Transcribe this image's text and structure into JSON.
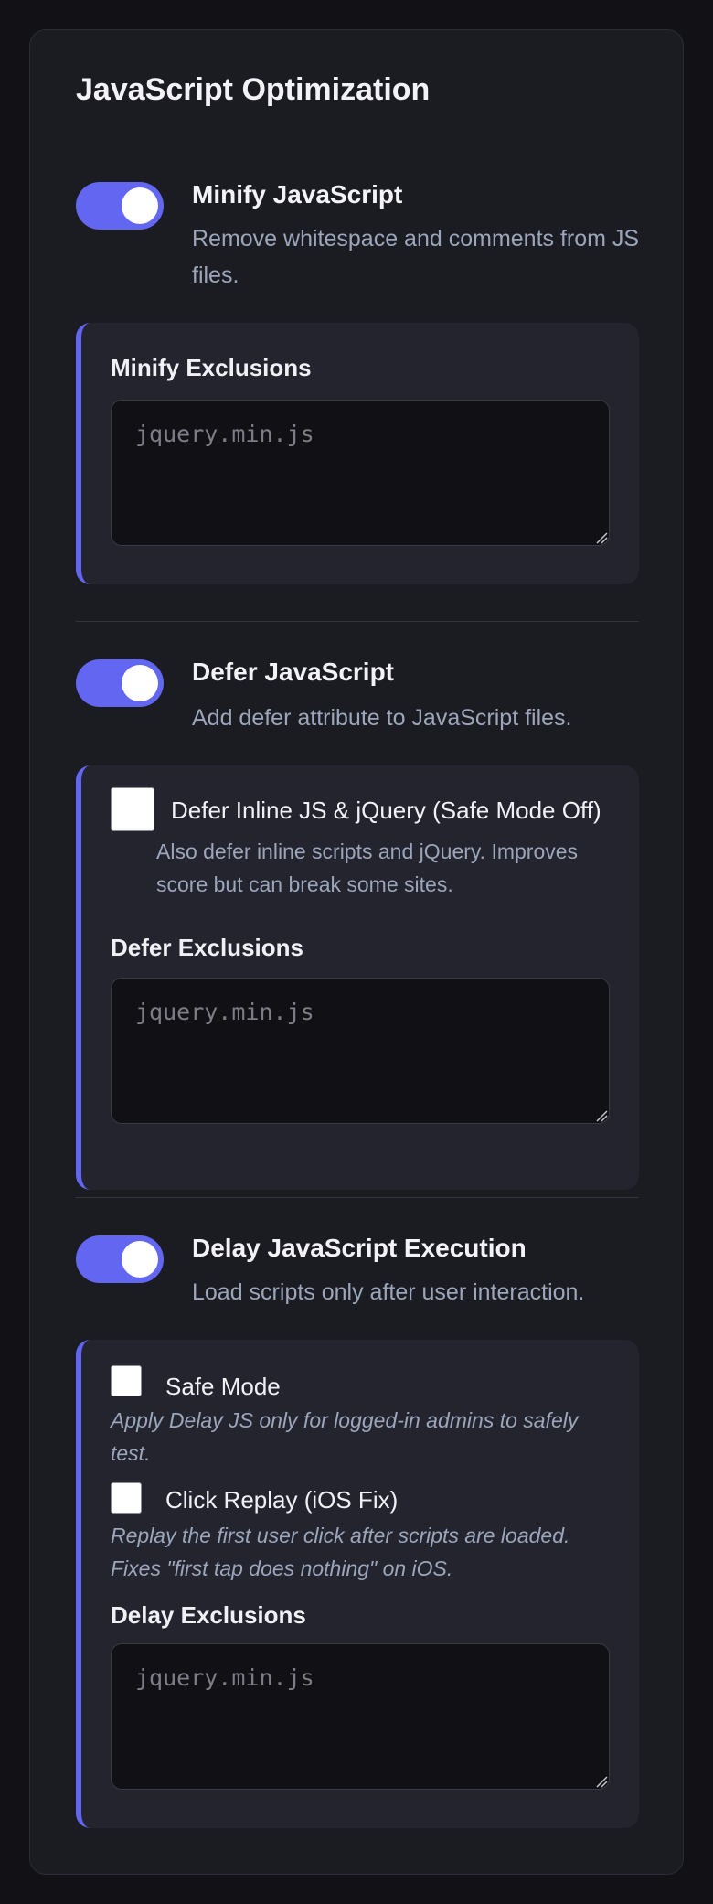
{
  "panel": {
    "title": "JavaScript Optimization"
  },
  "minify": {
    "title": "Minify JavaScript",
    "description": "Remove whitespace and comments from JS files.",
    "enabled": true,
    "exclusions_label": "Minify Exclusions",
    "exclusions_placeholder": "jquery.min.js",
    "exclusions_value": ""
  },
  "defer": {
    "title": "Defer JavaScript",
    "description": "Add defer attribute to JavaScript files.",
    "enabled": true,
    "inline_label": "Defer Inline JS & jQuery (Safe Mode Off)",
    "inline_description": "Also defer inline scripts and jQuery. Improves score but can break some sites.",
    "inline_checked": false,
    "exclusions_label": "Defer Exclusions",
    "exclusions_placeholder": "jquery.min.js",
    "exclusions_value": ""
  },
  "delay": {
    "title": "Delay JavaScript Execution",
    "description": "Load scripts only after user interaction.",
    "enabled": true,
    "safe_mode_label": "Safe Mode",
    "safe_mode_description": "Apply Delay JS only for logged-in admins to safely test.",
    "safe_mode_checked": false,
    "click_replay_label": "Click Replay (iOS Fix)",
    "click_replay_description": "Replay the first user click after scripts are loaded. Fixes \"first tap does nothing\" on iOS.",
    "click_replay_checked": false,
    "exclusions_label": "Delay Exclusions",
    "exclusions_placeholder": "jquery.min.js",
    "exclusions_value": ""
  },
  "colors": {
    "accent": "#6366f1",
    "background": "#111116",
    "card": "#1b1b22",
    "sub_panel": "#24242f",
    "muted_text": "#9ba6bb"
  }
}
